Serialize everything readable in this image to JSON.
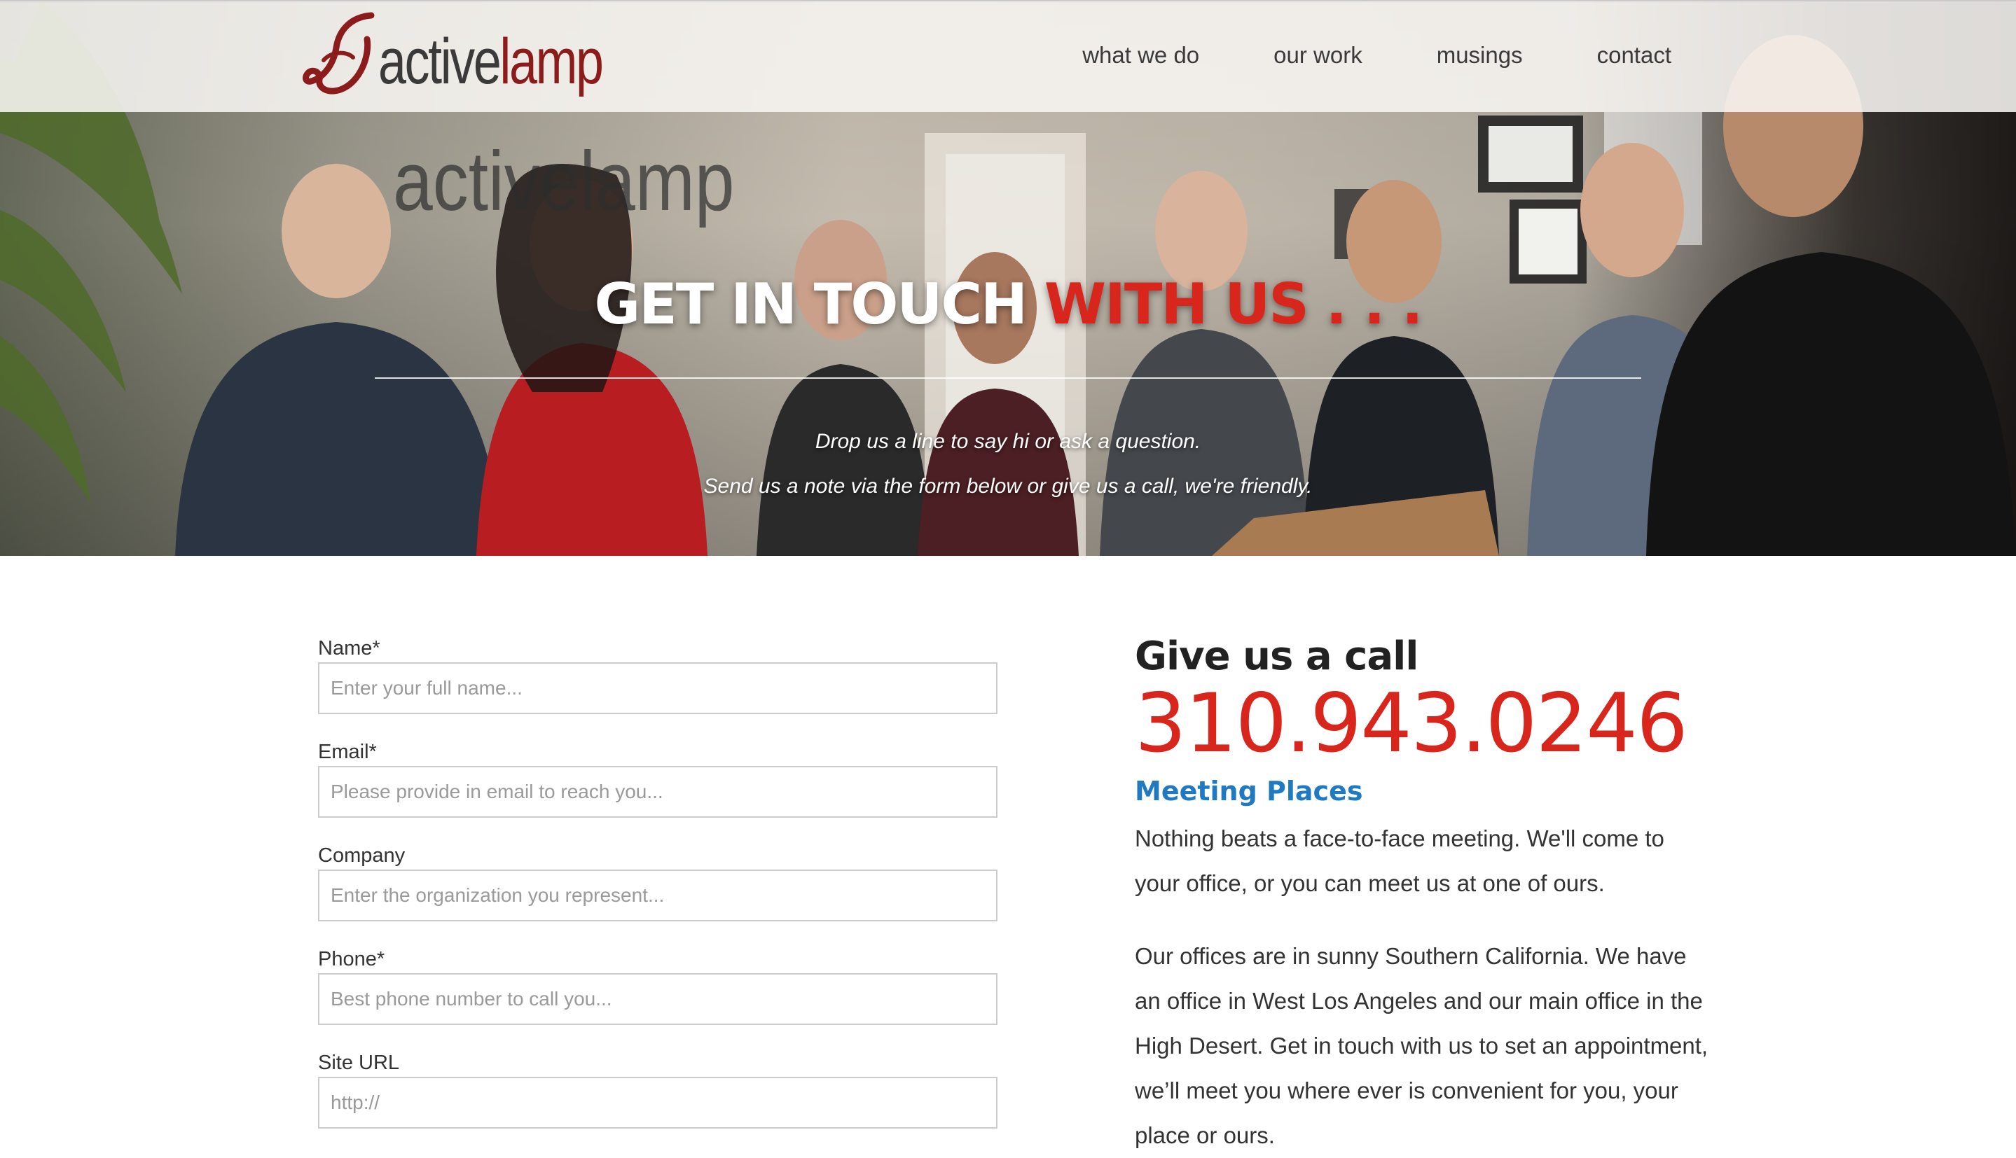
{
  "colors": {
    "accent_red": "#d8261c",
    "logo_red": "#8c1c1c",
    "link_blue": "#1f7ac2",
    "text": "#333333"
  },
  "brand": {
    "logo_part1": "active",
    "logo_part2": "lamp"
  },
  "nav": {
    "items": [
      {
        "label": "what we do"
      },
      {
        "label": "our work"
      },
      {
        "label": "musings"
      },
      {
        "label": "contact"
      }
    ]
  },
  "hero": {
    "title_white": "GET IN TOUCH",
    "title_red": "WITH US . . .",
    "subtitle_line1": "Drop us a line to say hi or ask a question.",
    "subtitle_line2": "Send us a note via the form below or give us a call, we're friendly."
  },
  "form": {
    "fields": [
      {
        "label": "Name*",
        "placeholder": "Enter your full name...",
        "value": ""
      },
      {
        "label": "Email*",
        "placeholder": "Please provide in email to reach you...",
        "value": ""
      },
      {
        "label": "Company",
        "placeholder": "Enter the organization you represent...",
        "value": ""
      },
      {
        "label": "Phone*",
        "placeholder": "Best phone number to call you...",
        "value": ""
      },
      {
        "label": "Site URL",
        "placeholder": "http://",
        "value": ""
      }
    ]
  },
  "contact": {
    "call_heading": "Give us a call",
    "phone": "310.943.0246",
    "meeting_heading": "Meeting Places",
    "paragraph1": "Nothing beats a face-to-face meeting. We'll come to your office, or you can meet us at one of ours.",
    "paragraph2": "Our offices are in sunny Southern California. We have an office in West Los Angeles and our main office in the High Desert. Get in touch with us to set an appointment, we’ll meet you where ever is convenient for you, your place or ours."
  }
}
